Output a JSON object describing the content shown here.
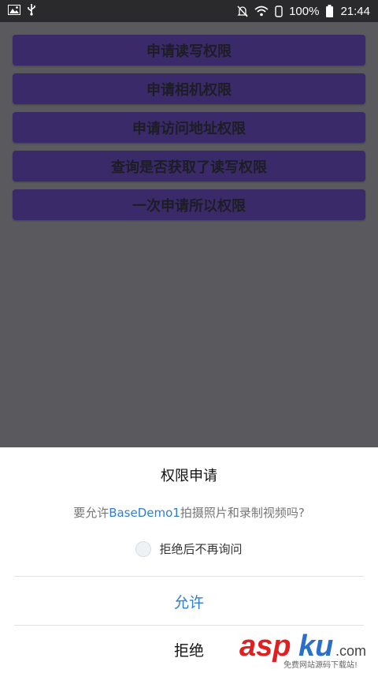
{
  "status_bar": {
    "battery": "100%",
    "time": "21:44",
    "icons": [
      "image-icon",
      "usb-icon",
      "mute-icon",
      "wifi-icon",
      "phone-icon",
      "battery-icon"
    ]
  },
  "app": {
    "buttons": [
      {
        "label": "申请读写权限"
      },
      {
        "label": "申请相机权限"
      },
      {
        "label": "申请访问地址权限"
      },
      {
        "label": "查询是否获取了读写权限"
      },
      {
        "label": "一次申请所以权限"
      }
    ]
  },
  "dialog": {
    "title": "权限申请",
    "message_prefix": "要允许",
    "app_name": "BaseDemo1",
    "message_suffix": "拍摄照片和录制视频吗?",
    "checkbox_label": "拒绝后不再询问",
    "allow_label": "允许",
    "deny_label": "拒绝"
  },
  "watermark": {
    "brand_a": "asp",
    "brand_b": "ku",
    "brand_c": ".com",
    "tagline": "免费网站源码下载站!"
  },
  "colors": {
    "accent": "#2f7fd1",
    "button_bg": "#3a2a6a",
    "overlay": "#5a5a5e",
    "watermark_red": "#e02020",
    "watermark_blue": "#2a6fc9"
  }
}
